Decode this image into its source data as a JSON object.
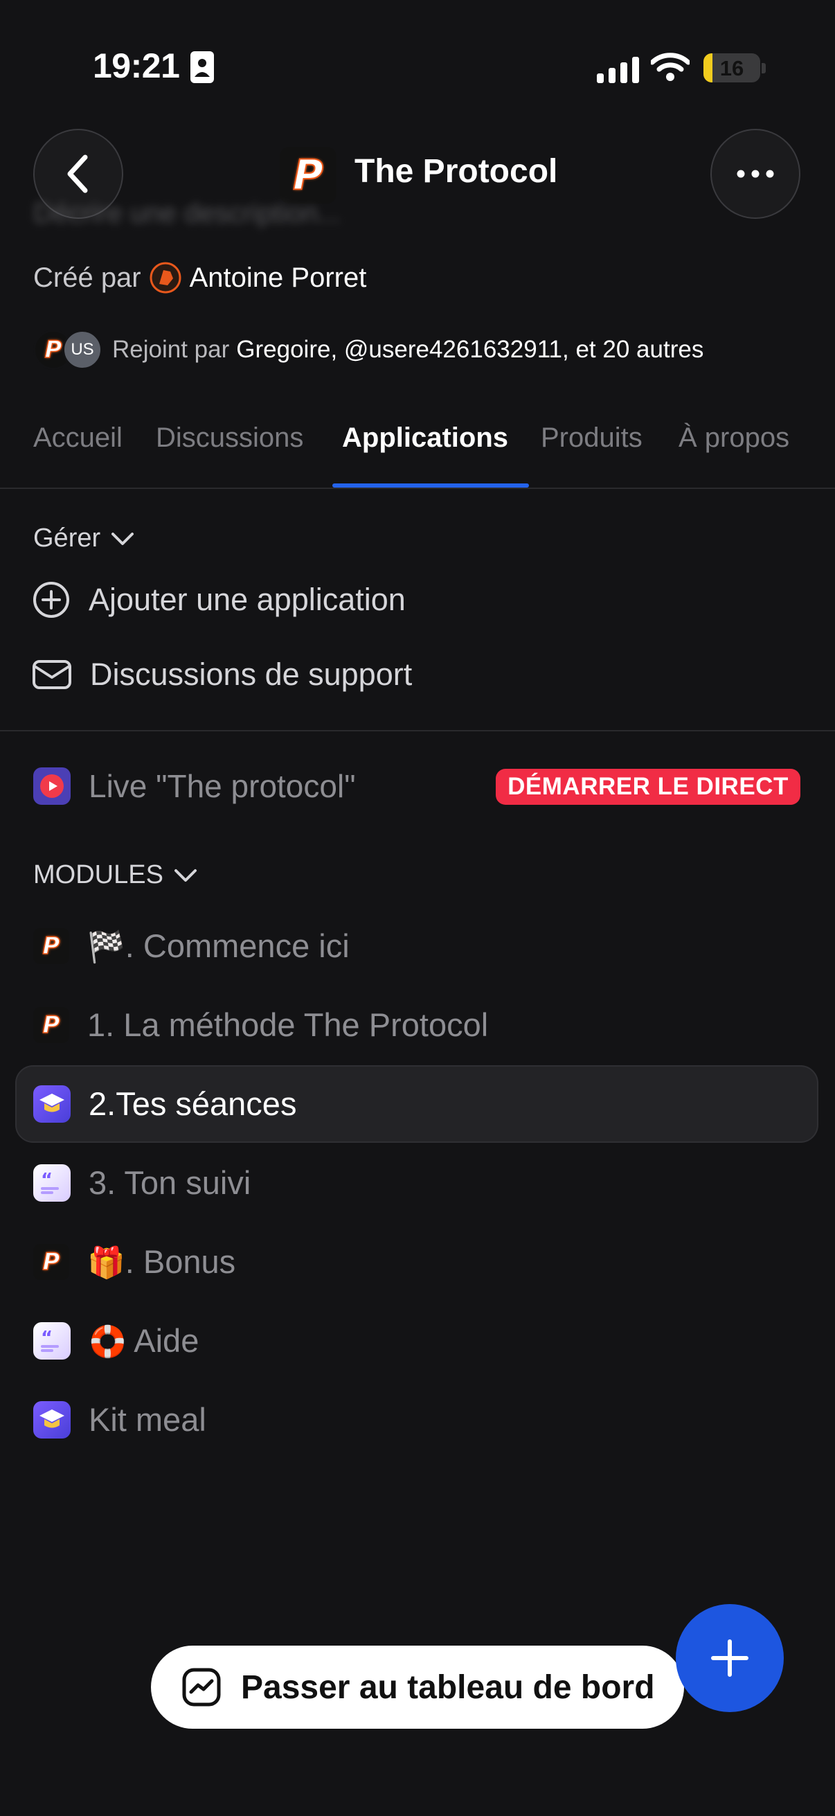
{
  "status_bar": {
    "time": "19:21",
    "battery": "16",
    "battery_color": "#f2cc1e"
  },
  "header": {
    "title": "The Protocol",
    "description_placeholder": "Décrire une description...",
    "logo_letter": "P"
  },
  "creator": {
    "prefix": "Créé par",
    "name": "Antoine Porret"
  },
  "members": {
    "avatar_initials": "US",
    "prefix": "Rejoint par",
    "names": "Gregoire, @usere4261632911, et 20 autres"
  },
  "tabs": [
    {
      "label": "Accueil",
      "active": false
    },
    {
      "label": "Discussions",
      "active": false
    },
    {
      "label": "Applications",
      "active": true
    },
    {
      "label": "Produits",
      "active": false
    },
    {
      "label": "À propos",
      "active": false
    }
  ],
  "manage": {
    "label": "Gérer",
    "items": [
      {
        "label": "Ajouter une application",
        "icon": "plus-circle-icon"
      },
      {
        "label": "Discussions de support",
        "icon": "envelope-icon"
      }
    ]
  },
  "live": {
    "label": "Live \"The protocol\"",
    "badge": "DÉMARRER LE DIRECT",
    "badge_color": "#f12c45"
  },
  "modules": {
    "label": "MODULES",
    "items": [
      {
        "emoji": "🏁",
        "label": ". Commence ici",
        "icon": "protocol-logo"
      },
      {
        "emoji": "",
        "label": "1. La méthode The Protocol",
        "icon": "protocol-logo"
      },
      {
        "emoji": "",
        "label": "2.Tes séances",
        "icon": "course-cap-icon",
        "selected": true
      },
      {
        "emoji": "",
        "label": "3. Ton suivi",
        "icon": "quote-app-icon"
      },
      {
        "emoji": "🎁",
        "label": ". Bonus",
        "icon": "protocol-logo"
      },
      {
        "emoji": "🛟",
        "label": " Aide",
        "icon": "quote-app-icon"
      },
      {
        "emoji": "",
        "label": "Kit meal",
        "icon": "course-cap-icon"
      }
    ]
  },
  "bottom": {
    "dashboard_label": "Passer au tableau de bord",
    "accent": "#1d56e0"
  }
}
